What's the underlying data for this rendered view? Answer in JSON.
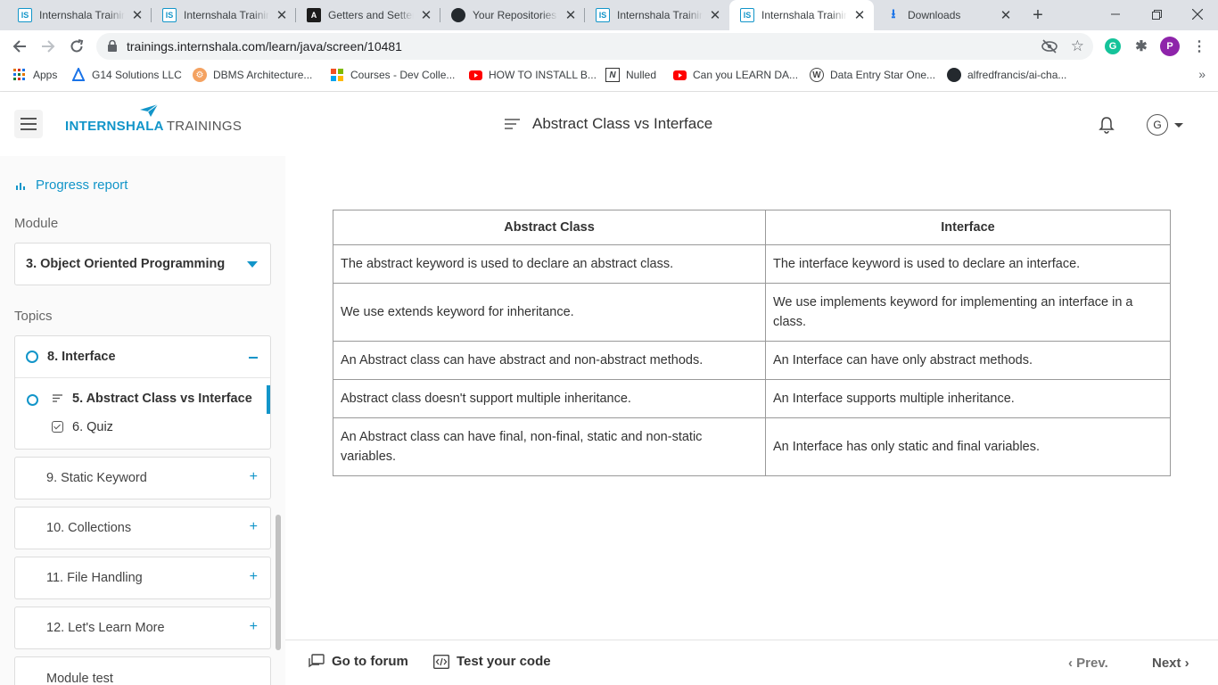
{
  "browser": {
    "tabs": [
      {
        "title": "Internshala Training",
        "favicon": "internshala-icon"
      },
      {
        "title": "Internshala Training",
        "favicon": "internshala-icon"
      },
      {
        "title": "Getters and Setters",
        "favicon": "code-logo-icon"
      },
      {
        "title": "Your Repositories",
        "favicon": "github-icon"
      },
      {
        "title": "Internshala Training",
        "favicon": "internshala-icon"
      },
      {
        "title": "Internshala Training",
        "favicon": "internshala-icon",
        "active": true
      },
      {
        "title": "Downloads",
        "favicon": "download-icon"
      }
    ],
    "url": "trainings.internshala.com/learn/java/screen/10481",
    "profile_initial": "P",
    "bookmarks": [
      {
        "label": "Apps",
        "icon": "apps-grid-icon"
      },
      {
        "label": "G14 Solutions LLC",
        "icon": "g14-logo-icon"
      },
      {
        "label": "DBMS Architecture...",
        "icon": "dbms-logo-icon"
      },
      {
        "label": "Courses - Dev Colle...",
        "icon": "microsoft-icon"
      },
      {
        "label": "HOW TO INSTALL B...",
        "icon": "youtube-icon"
      },
      {
        "label": "Nulled",
        "icon": "nulled-icon"
      },
      {
        "label": "Can you LEARN DA...",
        "icon": "youtube-icon"
      },
      {
        "label": "Data Entry Star One...",
        "icon": "wordpress-icon"
      },
      {
        "label": "alfredfrancis/ai-cha...",
        "icon": "github-icon"
      }
    ]
  },
  "header": {
    "logo_part1": "INTERN",
    "logo_part2": "SHALA",
    "logo_part3": "TRAININGS",
    "page_title": "Abstract Class vs Interface",
    "avatar_initial": "G"
  },
  "sidebar": {
    "progress_label": "Progress report",
    "module_label": "Module",
    "module_selected": "3. Object Oriented Programming",
    "topics_label": "Topics",
    "open_topic": {
      "title": "8. Interface",
      "subitems": [
        {
          "label": "5. Abstract Class vs Interface",
          "current": true
        },
        {
          "label": "6. Quiz",
          "current": false
        }
      ]
    },
    "topics": [
      {
        "label": "9. Static Keyword"
      },
      {
        "label": "10. Collections"
      },
      {
        "label": "11. File Handling"
      },
      {
        "label": "12. Let's Learn More"
      },
      {
        "label": "Module test"
      }
    ]
  },
  "comparison_table": {
    "headers": [
      "Abstract Class",
      "Interface"
    ],
    "rows": [
      [
        "The abstract keyword is used to declare an abstract class.",
        "The interface keyword is used to declare an interface."
      ],
      [
        "We use extends keyword for inheritance.",
        "We use implements keyword for implementing an interface in a class."
      ],
      [
        "An Abstract class can have abstract and non-abstract methods.",
        "An Interface can have only abstract methods."
      ],
      [
        "Abstract class doesn't support multiple inheritance.",
        "An Interface supports multiple inheritance."
      ],
      [
        "An Abstract class can have final, non-final, static and non-static variables.",
        "An Interface has only static and final variables."
      ]
    ]
  },
  "footer": {
    "forum_label": "Go to forum",
    "test_code_label": "Test your code",
    "prev_label": "‹ Prev.",
    "next_label": "Next ›"
  },
  "colors": {
    "brand_blue": "#1295c9",
    "text_dark": "#333333"
  }
}
